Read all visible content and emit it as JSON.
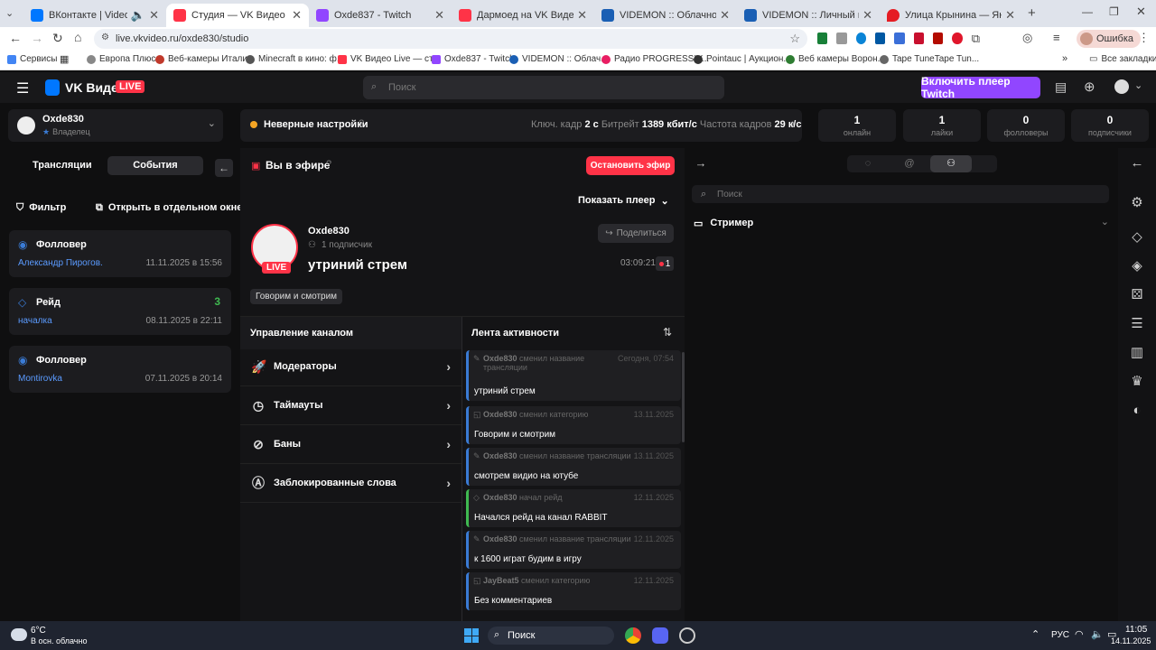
{
  "browser": {
    "tabs": [
      {
        "title": "ВКонтакте | Video Ext",
        "fav_color": "#0077ff",
        "active": false
      },
      {
        "title": "Студия — VK Видео Live",
        "fav_color": "#ff3347",
        "active": true
      },
      {
        "title": "Oxde837 - Twitch",
        "fav_color": "#9146ff",
        "active": false
      },
      {
        "title": "Дармоед на VK Видео Live – с",
        "fav_color": "#ff3347",
        "active": false
      },
      {
        "title": "VIDEMON :: Облачное видео",
        "fav_color": "#1a5fb4",
        "active": false
      },
      {
        "title": "VIDEMON :: Личный кабинет",
        "fav_color": "#1a5fb4",
        "active": false
      },
      {
        "title": "Улица Крынина — Яндекс Кар",
        "fav_color": "#e51c23",
        "active": false
      }
    ],
    "url": "live.vkvideo.ru/oxde830/studio",
    "error_label": "Ошибка",
    "bookmarks": [
      "Сервисы",
      "Европа Плюс",
      "Веб-камеры Италии",
      "Minecraft в кино: ф...",
      "VK Видео Live — ст...",
      "Oxde837 - Twitch",
      "VIDEMON :: Облач...",
      "Радио PROGRESSIV...",
      "Pointauc | Аукцион...",
      "Веб камеры Ворон...",
      "Tape TuneTape Tun..."
    ],
    "all_bookmarks": "Все закладки"
  },
  "app": {
    "logo": "VK Видео",
    "logo_live": "LIVE",
    "search_placeholder": "Поиск",
    "twitch_button": "Включить плеер Twitch"
  },
  "channel": {
    "name": "Oxde830",
    "role": "Владелец",
    "settings_status": "Неверные настройки",
    "keyframe_label": "Ключ. кадр",
    "keyframe_value": "2 с",
    "bitrate_label": "Битрейт",
    "bitrate_value": "1389 кбит/с",
    "framerate_label": "Частота кадров",
    "framerate_value": "29 к/с"
  },
  "stats": [
    {
      "value": "1",
      "label": "онлайн"
    },
    {
      "value": "1",
      "label": "лайки"
    },
    {
      "value": "0",
      "label": "фолловеры"
    },
    {
      "value": "0",
      "label": "подписчики"
    }
  ],
  "left": {
    "tab_streams": "Трансляции",
    "tab_events": "События",
    "filter": "Фильтр",
    "open_window": "Открыть в отдельном окне",
    "events": [
      {
        "type": "Фолловер",
        "name": "Александр Пирогов.",
        "date": "11.11.2025 в 15:56",
        "count": ""
      },
      {
        "type": "Рейд",
        "name": "началка",
        "date": "08.11.2025 в 22:11",
        "count": "3"
      },
      {
        "type": "Фолловер",
        "name": "Montirovka",
        "date": "07.11.2025 в 20:14",
        "count": ""
      }
    ]
  },
  "stream": {
    "live_title": "Вы в эфире",
    "stop_button": "Остановить эфир",
    "show_player": "Показать плеер",
    "streamer": "Oxde830",
    "subscribers": "1 подписчик",
    "title": "утриний стрем",
    "live_badge": "LIVE",
    "share": "Поделиться",
    "uptime": "03:09:21",
    "viewers": "1",
    "category": "Говорим и смотрим"
  },
  "channel_mgmt": {
    "title": "Управление каналом",
    "items": [
      "Модераторы",
      "Таймауты",
      "Баны",
      "Заблокированные слова"
    ]
  },
  "feed": {
    "title": "Лента активности",
    "items": [
      {
        "user": "Oxde830",
        "action": "сменил название трансляции",
        "when": "Сегодня, 07:54",
        "msg": "утриний стрем",
        "color": "#3a7bd5"
      },
      {
        "user": "Oxde830",
        "action": "сменил категорию",
        "when": "13.11.2025",
        "msg": "Говорим и смотрим",
        "color": "#3a7bd5"
      },
      {
        "user": "Oxde830",
        "action": "сменил название трансляции",
        "when": "13.11.2025",
        "msg": "смотрем видио на ютубе",
        "color": "#3a7bd5"
      },
      {
        "user": "Oxde830",
        "action": "начал рейд",
        "when": "12.11.2025",
        "msg": "Начался рейд на канал RABBIT",
        "color": "#3fb950"
      },
      {
        "user": "Oxde830",
        "action": "сменил название трансляции",
        "when": "12.11.2025",
        "msg": "к 1600 играт будим в игру",
        "color": "#3a7bd5"
      },
      {
        "user": "JayBeat5",
        "action": "сменил категорию",
        "when": "12.11.2025",
        "msg": "Без комментариев",
        "color": "#3a7bd5"
      }
    ]
  },
  "chat": {
    "search_placeholder": "Поиск",
    "section": "Стример"
  },
  "taskbar": {
    "temp": "6°C",
    "weather": "В осн. облачно",
    "search": "Поиск",
    "lang": "РУС",
    "time": "11:05",
    "date": "14.11.2025"
  }
}
